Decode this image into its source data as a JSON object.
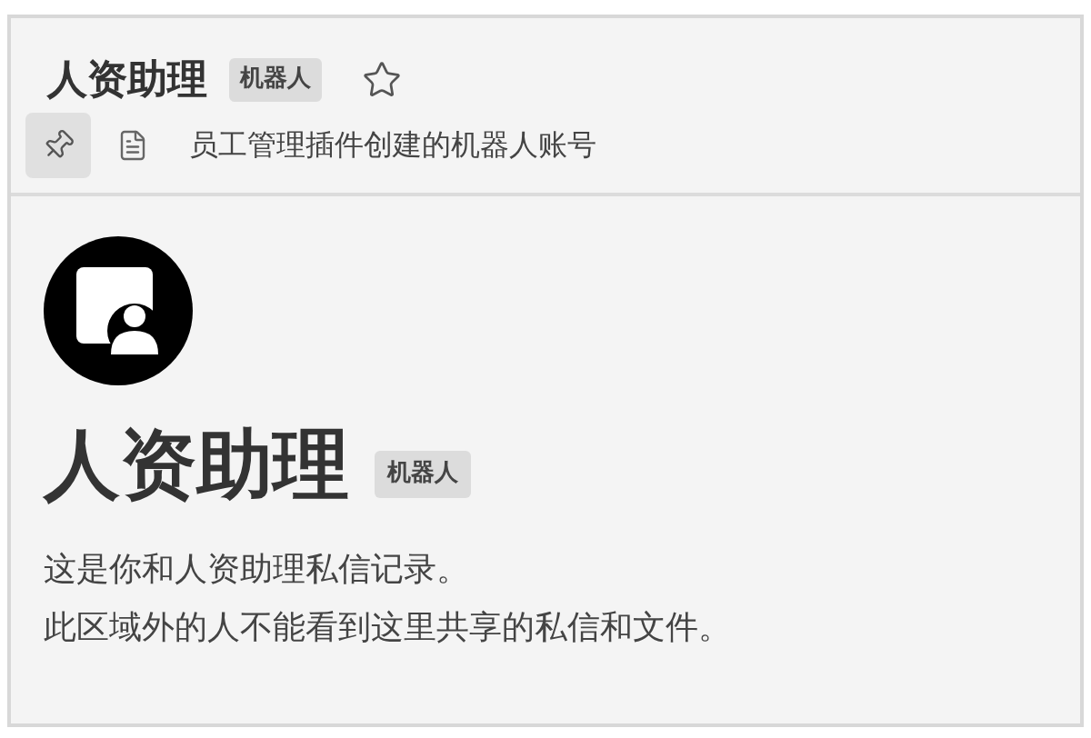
{
  "header": {
    "title": "人资助理",
    "badge": "机器人",
    "starred": false,
    "pinned": true,
    "description": "员工管理插件创建的机器人账号"
  },
  "intro": {
    "title": "人资助理",
    "badge": "机器人",
    "lines": [
      "这是你和人资助理私信记录。",
      "此区域外的人不能看到这里共享的私信和文件。"
    ]
  }
}
